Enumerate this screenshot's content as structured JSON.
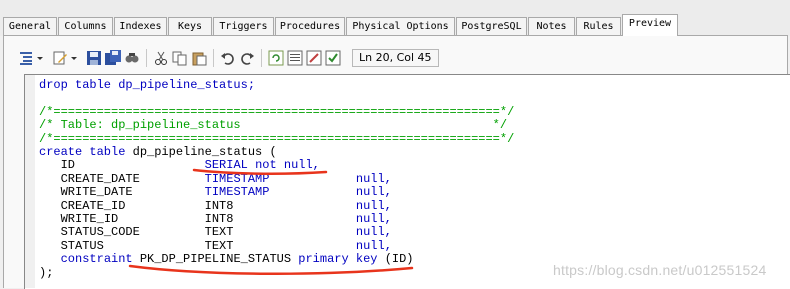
{
  "tabs": [
    "General",
    "Columns",
    "Indexes",
    "Keys",
    "Triggers",
    "Procedures",
    "Physical Options",
    "PostgreSQL",
    "Notes",
    "Rules",
    "Preview"
  ],
  "active_tab": "Preview",
  "toolbar": {
    "icons": [
      "indent-icon",
      "dropdown-icon",
      "edit-icon",
      "dropdown-icon",
      "save-icon",
      "save-all-icon",
      "find-icon",
      "cut-icon",
      "copy-icon",
      "paste-icon",
      "undo-icon",
      "redo-icon",
      "refresh-icon",
      "list-icon",
      "properties-icon",
      "check-icon"
    ],
    "cursor_position": "Ln 20, Col 45"
  },
  "sql": {
    "l1": "drop table dp_pipeline_status;",
    "l2": "/*==============================================================*/",
    "l3": "/* Table: dp_pipeline_status                                   */",
    "l4": "/*==============================================================*/",
    "l5_kw": "create table",
    "l5_rest": " dp_pipeline_status (",
    "rows": [
      {
        "name": "ID",
        "type": "SERIAL",
        "extra": "not null,"
      },
      {
        "name": "CREATE_DATE",
        "type": "TIMESTAMP",
        "extra": "null,"
      },
      {
        "name": "WRITE_DATE",
        "type": "TIMESTAMP",
        "extra": "null,"
      },
      {
        "name": "CREATE_ID",
        "type": "INT8",
        "extra": "null,"
      },
      {
        "name": "WRITE_ID",
        "type": "INT8",
        "extra": "null,"
      },
      {
        "name": "STATUS_CODE",
        "type": "TEXT",
        "extra": "null,"
      },
      {
        "name": "STATUS",
        "type": "TEXT",
        "extra": "null,"
      }
    ],
    "constraint_kw": "constraint",
    "constraint_name": "PK_DP_PIPELINE_STATUS",
    "primary_key_kw": "primary key",
    "constraint_cols": "(ID)",
    "close": ");"
  },
  "watermark": "https://blog.csdn.net/u012551524",
  "colors": {
    "keyword": "#0000c0",
    "comment": "#00a000",
    "annotation": "#e8341c"
  }
}
